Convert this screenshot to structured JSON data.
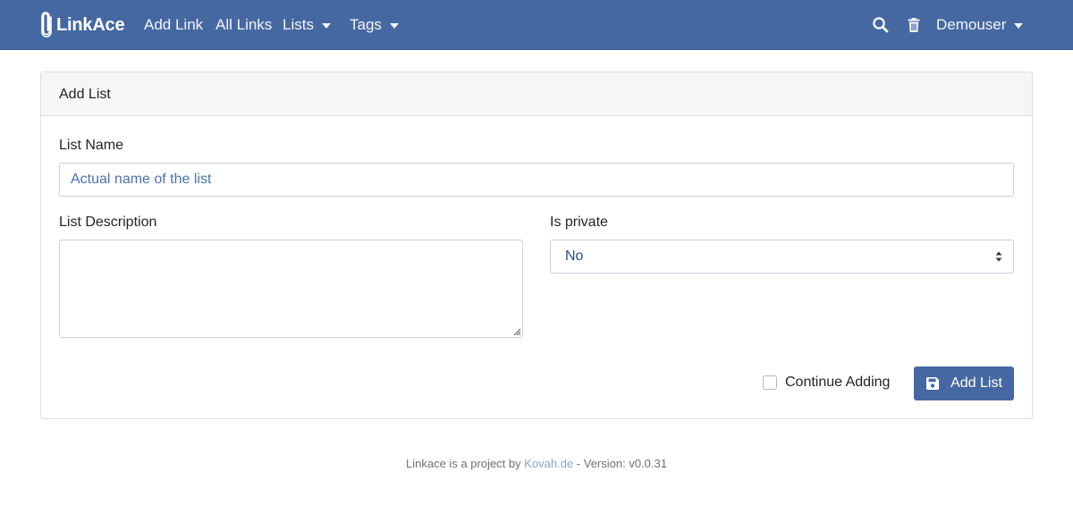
{
  "navbar": {
    "brand": "LinkAce",
    "items": [
      {
        "label": "Add Link"
      },
      {
        "label": "All Links"
      },
      {
        "label": "Lists"
      },
      {
        "label": "Tags"
      }
    ],
    "user": "Demouser",
    "icons": [
      "search-icon",
      "trash-icon"
    ]
  },
  "card": {
    "title": "Add List",
    "list_name": {
      "label": "List Name",
      "placeholder": "Actual name of the list"
    },
    "list_description": {
      "label": "List Description",
      "value": ""
    },
    "is_private": {
      "label": "Is private",
      "selected": "No"
    },
    "continue_adding": {
      "label": "Continue Adding",
      "checked": false
    },
    "submit_label": "Add List"
  },
  "footer": {
    "prefix": "Linkace is a project by ",
    "link": "Kovah.de",
    "suffix": " - Version: v0.0.31"
  },
  "colors": {
    "navbar": "#4668a2",
    "primary": "#4668a2",
    "card_header": "#f6f6f6"
  }
}
